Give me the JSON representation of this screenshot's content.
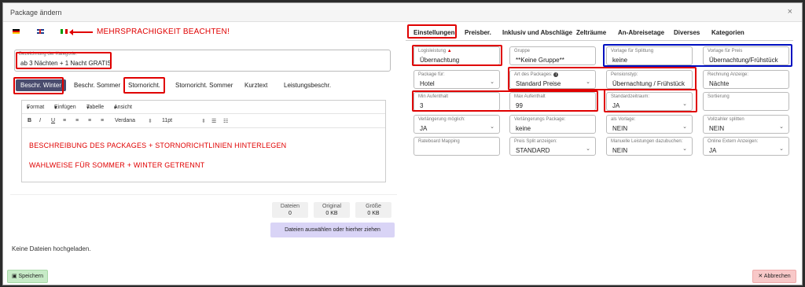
{
  "dialog": {
    "title": "Package ändern",
    "close_glyph": "×"
  },
  "note": "MEHRSPRACHIGKEIT BEACHTEN!",
  "category": {
    "label": "Bezeichnung der Kategorie:",
    "value": "ab 3 Nächten + 1 Nacht GRATIS"
  },
  "left_tabs": [
    "Beschr. Winter",
    "Beschr. Sommer",
    "Stornoricht.",
    "Stornoricht. Sommer",
    "Kurztext",
    "Leistungsbeschr."
  ],
  "editor": {
    "menu": [
      "Format",
      "Einfügen",
      "Tabelle",
      "Ansicht"
    ],
    "font": "Verdana",
    "size": "11pt",
    "line1": "BESCHREIBUNG DES PACKAGES + STORNORICHTLINIEN HINTERLEGEN",
    "line2": "WAHLWEISE FÜR SOMMER + WINTER GETRENNT"
  },
  "stats": [
    {
      "title": "Dateien",
      "value": "0"
    },
    {
      "title": "Original",
      "value": "0 KB"
    },
    {
      "title": "Größe",
      "value": "0 KB"
    }
  ],
  "upload_label": "Dateien auswählen oder hierher ziehen",
  "no_files": "Keine Dateien hochgeladen.",
  "save_label": "Speichern",
  "cancel_label": "Abbrechen",
  "right_tabs": [
    "Einstellungen",
    "Preisber.",
    "Inklusiv und Abschläge",
    "Zelträume",
    "An-Abreisetage",
    "Diverses",
    "Kategorien"
  ],
  "fields": {
    "logisleistung": {
      "label": "Logisleistung",
      "value": "Übernachtung"
    },
    "gruppe": {
      "label": "Gruppe",
      "value": "**Keine Gruppe**"
    },
    "vorlage_splittung": {
      "label": "Vorlage für Splittung",
      "value": "keine"
    },
    "vorlage_preis": {
      "label": "Vorlage für Preis",
      "value": "Übernachtung/Frühstück"
    },
    "package_fuer": {
      "label": "Package für:",
      "value": "Hotel"
    },
    "art_package": {
      "label": "Art des Packages:",
      "value": "Standard Preise"
    },
    "pensionstyp": {
      "label": "Pensionstyp:",
      "value": "Übernachtung / Frühstück"
    },
    "rechnung_anzeige": {
      "label": "Rechnung Anzeige:",
      "value": "Nächte"
    },
    "min_aufenthalt": {
      "label": "Min Aufenthalt",
      "value": "3"
    },
    "max_aufenthalt": {
      "label": "Max Aufenthalt",
      "value": "99"
    },
    "standardzeitraum": {
      "label": "Standardzeitraum:",
      "value": "JA"
    },
    "sortierung": {
      "label": "Sortierung",
      "value": ""
    },
    "verlaengerung_moeglich": {
      "label": "Verlängerung möglich:",
      "value": "JA"
    },
    "verlaengerungs_package": {
      "label": "Verlängerungs Package:",
      "value": "keine"
    },
    "als_vorlage": {
      "label": "als Vorlage:",
      "value": "NEIN"
    },
    "vollzahler_splitten": {
      "label": "Vollzahler splitten",
      "value": "NEIN"
    },
    "rateboard_mapping": {
      "label": "Rateboard Mapping",
      "value": ""
    },
    "preis_split": {
      "label": "Preis Split anzeigen:",
      "value": "STANDARD"
    },
    "manuelle_leistungen": {
      "label": "Manuelle Leistungen dazubuchen:",
      "value": "NEIN"
    },
    "online_extern": {
      "label": "Online Extern Anzeigen:",
      "value": "JA"
    }
  }
}
